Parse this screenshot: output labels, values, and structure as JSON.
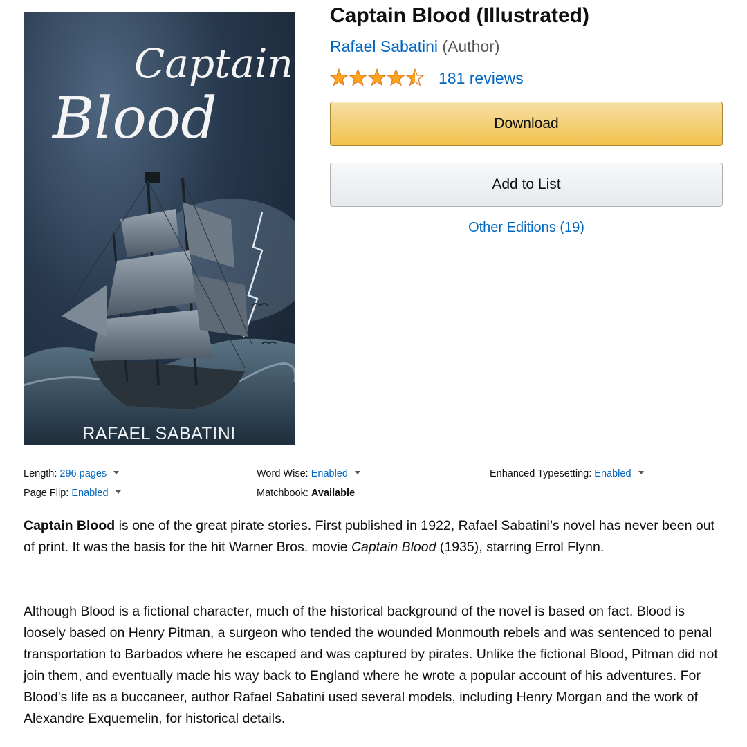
{
  "cover": {
    "title_line1": "Captain",
    "title_line2": "Blood",
    "author": "RAFAEL SABATINI"
  },
  "product": {
    "title": "Captain Blood (Illustrated)",
    "author_name": "Rafael Sabatini",
    "author_role": "(Author)",
    "rating": 4.5,
    "reviews_label": "181 reviews",
    "star_color": "#ffa41c"
  },
  "actions": {
    "download_label": "Download",
    "add_to_list_label": "Add to List",
    "other_editions_label": "Other Editions (19)"
  },
  "details": {
    "length_label": "Length:",
    "length_value": "296 pages",
    "word_wise_label": "Word Wise:",
    "word_wise_value": "Enabled",
    "typesetting_label": "Enhanced Typesetting:",
    "typesetting_value": "Enabled",
    "page_flip_label": "Page Flip:",
    "page_flip_value": "Enabled",
    "matchbook_label": "Matchbook:",
    "matchbook_value": "Available"
  },
  "description": {
    "p1_bold": "Captain Blood",
    "p1_text_a": " is one of the great pirate stories. First published in 1922, Rafael Sabatini’s novel has never been out of print. It was the basis for the hit Warner Bros. movie ",
    "p1_italic": "Captain Blood",
    "p1_text_b": " (1935), starring Errol Flynn.",
    "p2": "Although Blood is a fictional character, much of the historical background of the novel is based on fact. Blood is loosely based on Henry Pitman, a surgeon who tended the wounded Monmouth rebels and was sentenced to penal transportation to Barbados where he escaped and was captured by pirates. Unlike the fictional Blood, Pitman did not join them, and eventually made his way back to England where he wrote a popular account of his adventures. For Blood's life as a buccaneer, author Rafael Sabatini used several models, including Henry Morgan and the work of Alexandre Exquemelin, for historical details."
  },
  "colors": {
    "link": "#0066c0",
    "download_button": "#f0c14b",
    "text": "#0f1111"
  }
}
